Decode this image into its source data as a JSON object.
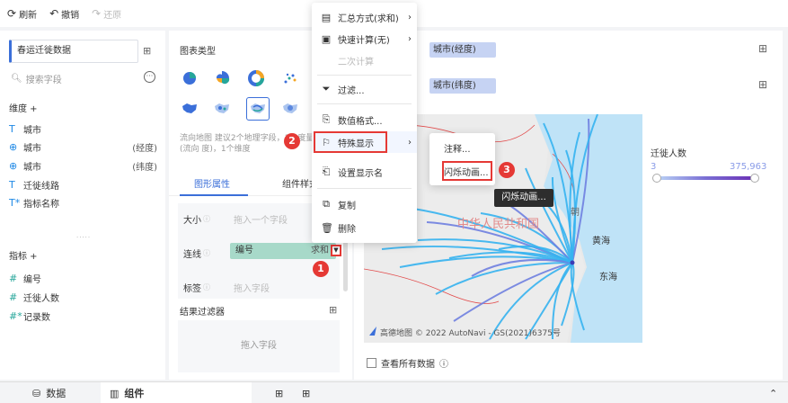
{
  "toolbar": {
    "refresh": "刷新",
    "undo": "撤销",
    "redo": "还原"
  },
  "left": {
    "dataset": "春运迁徙数据",
    "search_placeholder": "搜索字段",
    "dimension_title": "维度 +",
    "dimensions": [
      {
        "icon": "T",
        "label": "城市",
        "suffix": ""
      },
      {
        "icon": "globe",
        "label": "城市",
        "suffix": "(经度)"
      },
      {
        "icon": "globe",
        "label": "城市",
        "suffix": "(纬度)"
      },
      {
        "icon": "T",
        "label": "迁徙线路",
        "suffix": ""
      },
      {
        "icon": "T*",
        "label": "指标名称",
        "suffix": ""
      }
    ],
    "measure_title": "指标 +",
    "measures": [
      {
        "icon": "#",
        "label": "编号"
      },
      {
        "icon": "#",
        "label": "迁徙人数"
      },
      {
        "icon": "#*",
        "label": "记录数"
      }
    ]
  },
  "mid": {
    "chart_type_title": "图表类型",
    "hint": "流向地图 建议2个地理字段，1个度量(流向 度)，1个维度",
    "tab_props": "图形属性",
    "tab_style": "组件样式",
    "size_label": "大小",
    "size_placeholder": "拖入一个字段",
    "line_label": "连线",
    "line_field": "编号",
    "line_agg": "求和",
    "label_label": "标签",
    "label_placeholder": "拖入字段",
    "filter_title": "结果过滤器",
    "filter_placeholder": "拖入字段"
  },
  "right": {
    "lng_field": "城市(经度)",
    "lat_field": "城市(纬度)",
    "map_labels": {
      "country": "中华人民共和国",
      "yellow_sea": "黄海",
      "east_sea": "东海",
      "peninsula": "朝"
    },
    "map_attribution": "高德地图 © 2022 AutoNavi - GS(2021)6375号",
    "legend_title": "迁徙人数",
    "legend_min": "3",
    "legend_max": "375,963",
    "legend_colors": [
      "#bcd6f7",
      "#7a6fd4",
      "#6a2fb5"
    ],
    "show_all": "查看所有数据"
  },
  "menu": {
    "items": [
      {
        "label": "汇总方式(求和)",
        "icon": "summary-icon",
        "arrow": true,
        "disabled": false
      },
      {
        "label": "快速计算(无)",
        "icon": "calc-icon",
        "arrow": true,
        "disabled": false
      },
      {
        "label": "二次计算",
        "icon": "",
        "arrow": false,
        "disabled": true
      },
      {
        "label": "过滤...",
        "icon": "filter-icon",
        "arrow": false,
        "disabled": false
      },
      {
        "label": "数值格式...",
        "icon": "format-icon",
        "arrow": false,
        "disabled": false
      },
      {
        "label": "特殊显示",
        "icon": "flag-icon",
        "arrow": true,
        "disabled": false
      },
      {
        "label": "设置显示名",
        "icon": "rename-icon",
        "arrow": false,
        "disabled": false
      },
      {
        "label": "复制",
        "icon": "copy-icon",
        "arrow": false,
        "disabled": false
      },
      {
        "label": "删除",
        "icon": "delete-icon",
        "arrow": false,
        "disabled": false
      }
    ],
    "submenu": [
      {
        "label": "注释..."
      },
      {
        "label": "闪烁动画..."
      }
    ],
    "tooltip": "闪烁动画..."
  },
  "badges": [
    "1",
    "2",
    "3"
  ],
  "bottom": {
    "data_tab": "数据",
    "component_tab": "组件"
  },
  "colors": {
    "accent": "#3b6fd9",
    "highlight": "#e53935",
    "flow_line": "#35b3f0"
  }
}
